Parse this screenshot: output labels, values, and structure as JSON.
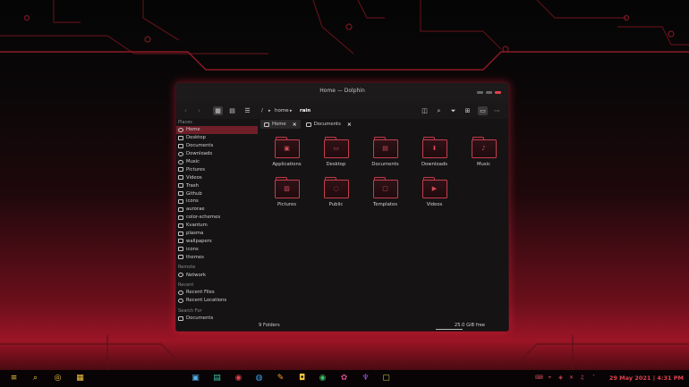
{
  "colors": {
    "accent": "#e0404e",
    "selection": "#6e1f28",
    "window_bg": "#151314",
    "sidebar_text": "#d5d5d5"
  },
  "window": {
    "title": "Home — Dolphin"
  },
  "breadcrumb": {
    "root": "/",
    "home": "home",
    "current": "rain"
  },
  "toolbar_icons": [
    "back-icon",
    "forward-icon",
    "icons-view-icon",
    "compact-view-icon",
    "details-view-icon",
    "split-icon",
    "search-icon",
    "filter-icon",
    "grid-icon",
    "preview-icon",
    "menu-icon"
  ],
  "sidebar": {
    "places_header": "Places",
    "places": [
      {
        "label": "Home",
        "icon": "home-icon",
        "selected": true
      },
      {
        "label": "Desktop",
        "icon": "desktop-icon"
      },
      {
        "label": "Documents",
        "icon": "documents-icon"
      },
      {
        "label": "Downloads",
        "icon": "downloads-icon"
      },
      {
        "label": "Music",
        "icon": "music-icon"
      },
      {
        "label": "Pictures",
        "icon": "pictures-icon"
      },
      {
        "label": "Videos",
        "icon": "videos-icon"
      },
      {
        "label": "Trash",
        "icon": "trash-icon"
      },
      {
        "label": "Github",
        "icon": "folder-icon"
      },
      {
        "label": "icons",
        "icon": "folder-icon"
      },
      {
        "label": "aurorae",
        "icon": "folder-icon"
      },
      {
        "label": "color-schemes",
        "icon": "folder-icon"
      },
      {
        "label": "Kvantum",
        "icon": "folder-icon"
      },
      {
        "label": "plasma",
        "icon": "folder-icon"
      },
      {
        "label": "wallpapers",
        "icon": "folder-icon"
      },
      {
        "label": "icons",
        "icon": "folder-icon"
      },
      {
        "label": "themes",
        "icon": "folder-icon"
      }
    ],
    "remote_header": "Remote",
    "remote": [
      {
        "label": "Network",
        "icon": "network-icon"
      }
    ],
    "recent_header": "Recent",
    "recent": [
      {
        "label": "Recent Files",
        "icon": "recent-files-icon"
      },
      {
        "label": "Recent Locations",
        "icon": "recent-locations-icon"
      }
    ],
    "search_header": "Search For",
    "search": [
      {
        "label": "Documents",
        "icon": "documents-icon"
      }
    ]
  },
  "tabs": [
    {
      "label": "Home",
      "icon": "home-icon",
      "active": true
    },
    {
      "label": "Documents",
      "icon": "documents-icon",
      "active": false
    }
  ],
  "files": [
    {
      "label": "Applications",
      "emblem": "applications-icon"
    },
    {
      "label": "Desktop",
      "emblem": "desktop-icon"
    },
    {
      "label": "Documents",
      "emblem": "documents-icon"
    },
    {
      "label": "Downloads",
      "emblem": "downloads-icon"
    },
    {
      "label": "Music",
      "emblem": "music-icon"
    },
    {
      "label": "Pictures",
      "emblem": "pictures-icon"
    },
    {
      "label": "Public",
      "emblem": "public-icon"
    },
    {
      "label": "Templates",
      "emblem": "templates-icon"
    },
    {
      "label": "Videos",
      "emblem": "videos-icon"
    }
  ],
  "status": {
    "count": "9 Folders",
    "free": "25.0 GiB free"
  },
  "taskbar": {
    "apps": [
      "app-launcher-icon",
      "search-icon",
      "circle-icon",
      "tiling-icon",
      "dolphin-icon",
      "files-icon",
      "browser-icon",
      "firefox-icon",
      "editor-icon",
      "store-icon",
      "spotify-icon",
      "settings-icon",
      "vpn-icon",
      "terminal-icon"
    ],
    "tray": [
      "keyboard-icon",
      "location-icon",
      "network-icon",
      "close-icon",
      "volume-icon",
      "chevron-up-icon"
    ],
    "clock": "29 May 2021 | 4:31 PM"
  }
}
